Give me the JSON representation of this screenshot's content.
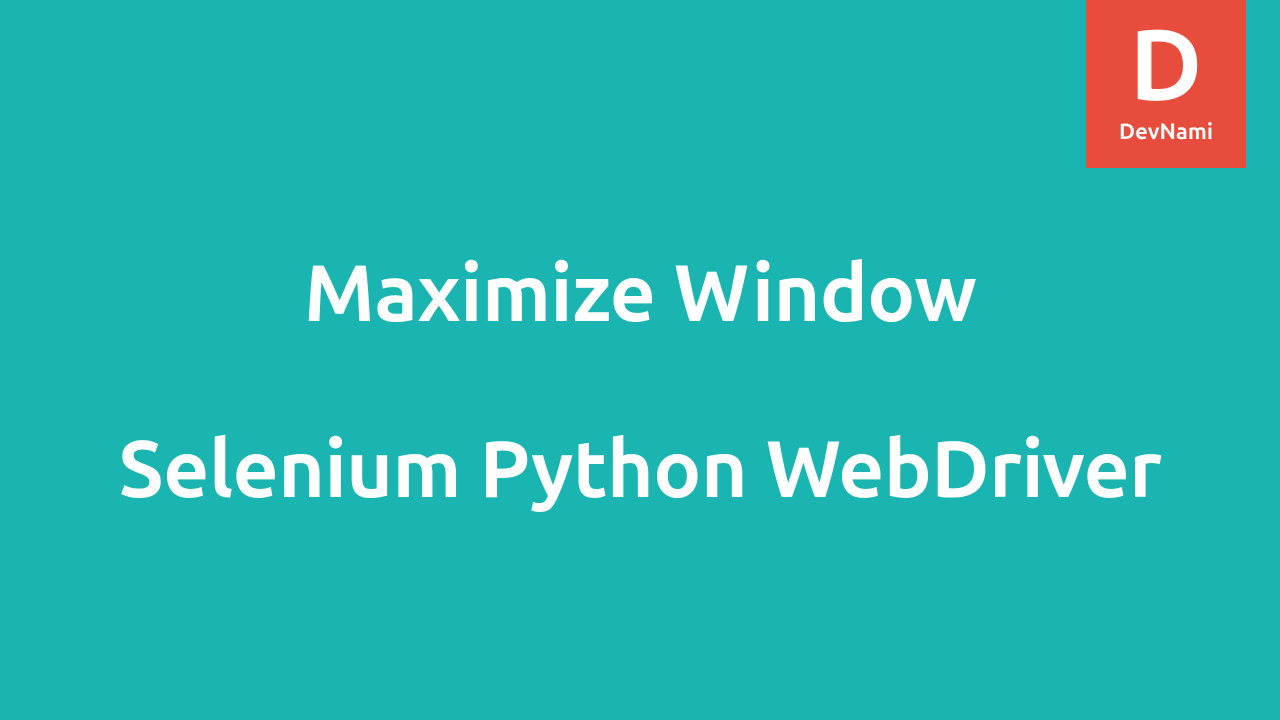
{
  "brand": {
    "letter": "D",
    "name": "DevNami"
  },
  "title": {
    "line1": "Maximize Window",
    "line2": "Selenium Python WebDriver"
  },
  "colors": {
    "background": "#1ab5b0",
    "badge": "#e74c3c",
    "text": "#ffffff"
  }
}
